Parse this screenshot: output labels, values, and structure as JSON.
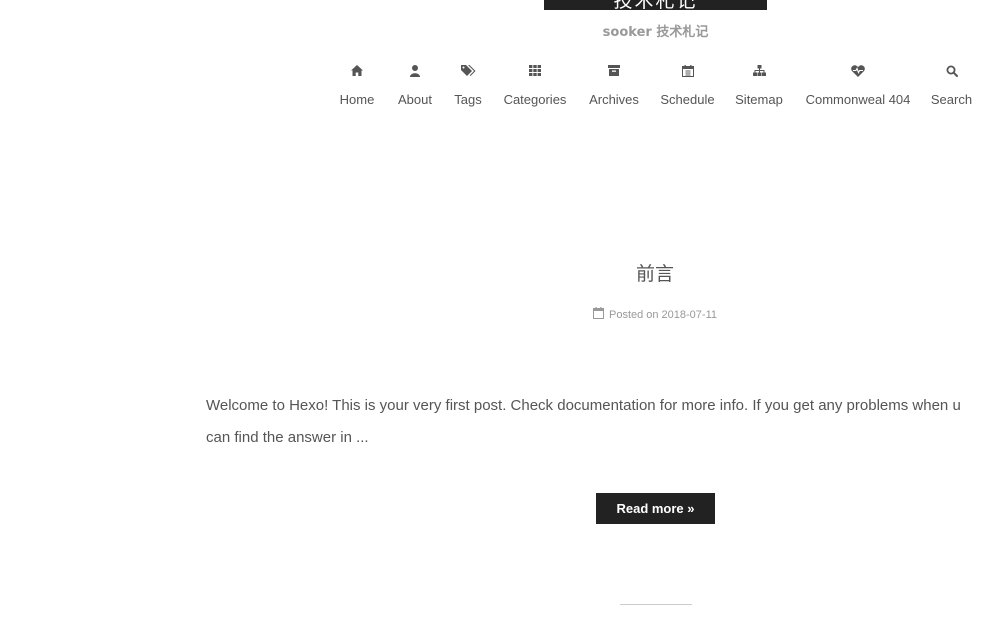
{
  "site": {
    "title": "技术札记",
    "subtitle": "sooker 技术札记"
  },
  "menu": [
    {
      "label": "Home",
      "icon": "home-icon"
    },
    {
      "label": "About",
      "icon": "user-icon"
    },
    {
      "label": "Tags",
      "icon": "tags-icon"
    },
    {
      "label": "Categories",
      "icon": "grid-icon"
    },
    {
      "label": "Archives",
      "icon": "archive-icon"
    },
    {
      "label": "Schedule",
      "icon": "calendar-icon"
    },
    {
      "label": "Sitemap",
      "icon": "sitemap-icon"
    },
    {
      "label": "Commonweal 404",
      "icon": "heartbeat-icon"
    },
    {
      "label": "Search",
      "icon": "search-icon"
    }
  ],
  "post": {
    "title": "前言",
    "meta_label": "Posted on",
    "date": "2018-07-11",
    "excerpt_line1": "Welcome to Hexo! This is your very first post. Check documentation for more info. If you get any problems when u",
    "excerpt_line2": "can find the answer in ...",
    "read_more": "Read more »"
  },
  "colors": {
    "text": "#555555",
    "muted": "#999999",
    "dark": "#222222"
  }
}
